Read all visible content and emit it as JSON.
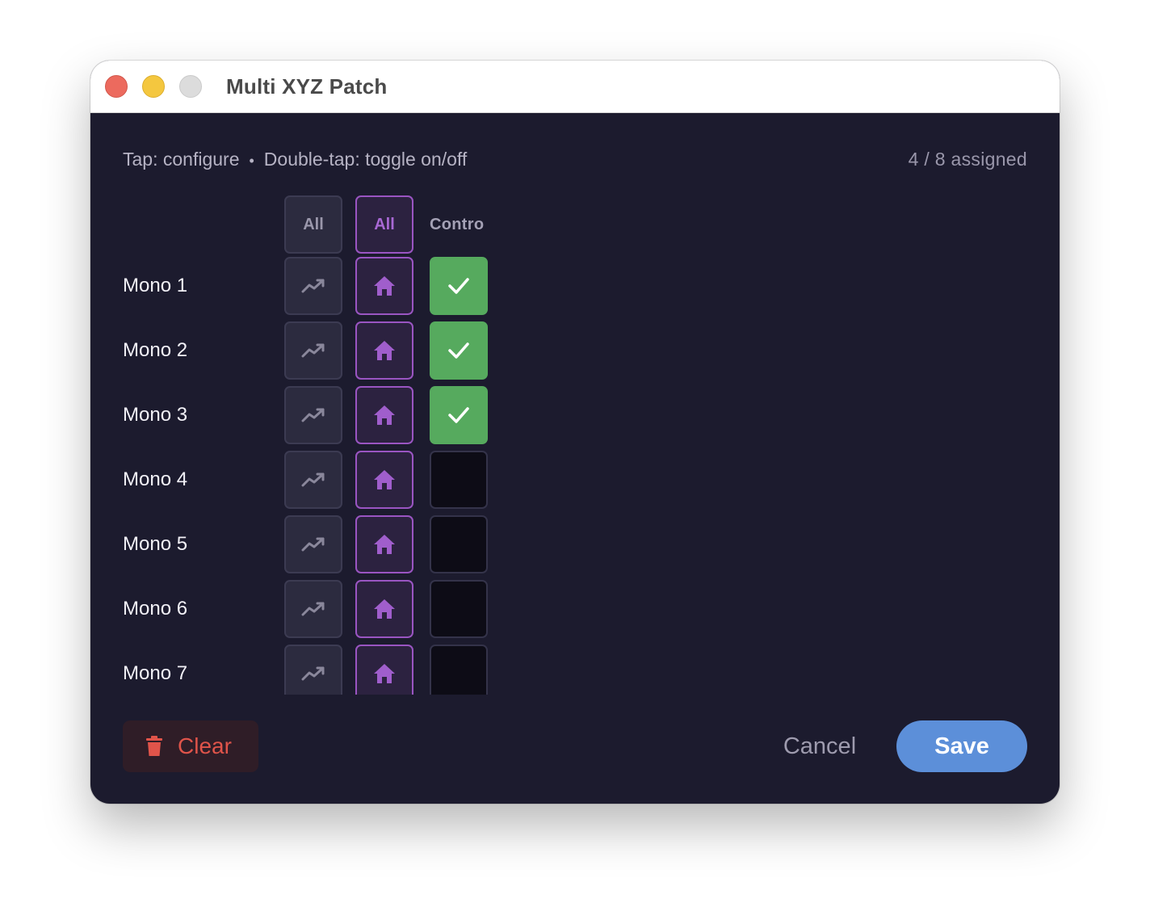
{
  "window": {
    "title": "Multi XYZ Patch"
  },
  "hint": {
    "tap": "Tap: configure",
    "separator": "•",
    "double_tap": "Double-tap: toggle on/off"
  },
  "status": {
    "assigned": "4 / 8 assigned"
  },
  "columns": {
    "col1_header": "All",
    "col2_header": "All",
    "col3_header": "Contro"
  },
  "icons": {
    "col1_cell": "trending-up-icon",
    "col2_cell": "home-icon",
    "check_on": "checkmark-icon",
    "clear": "trash-icon"
  },
  "rows": [
    {
      "label": "Mono 1",
      "enabled": true
    },
    {
      "label": "Mono 2",
      "enabled": true
    },
    {
      "label": "Mono 3",
      "enabled": true
    },
    {
      "label": "Mono 4",
      "enabled": false
    },
    {
      "label": "Mono 5",
      "enabled": false
    },
    {
      "label": "Mono 6",
      "enabled": false
    },
    {
      "label": "Mono 7",
      "enabled": false
    }
  ],
  "footer": {
    "clear_label": "Clear",
    "cancel_label": "Cancel",
    "save_label": "Save"
  },
  "colors": {
    "background": "#1c1b2e",
    "accent_purple": "#9a55c2",
    "check_green": "#56aa5e",
    "save_blue": "#5c8fd9",
    "clear_red": "#e0544a"
  }
}
